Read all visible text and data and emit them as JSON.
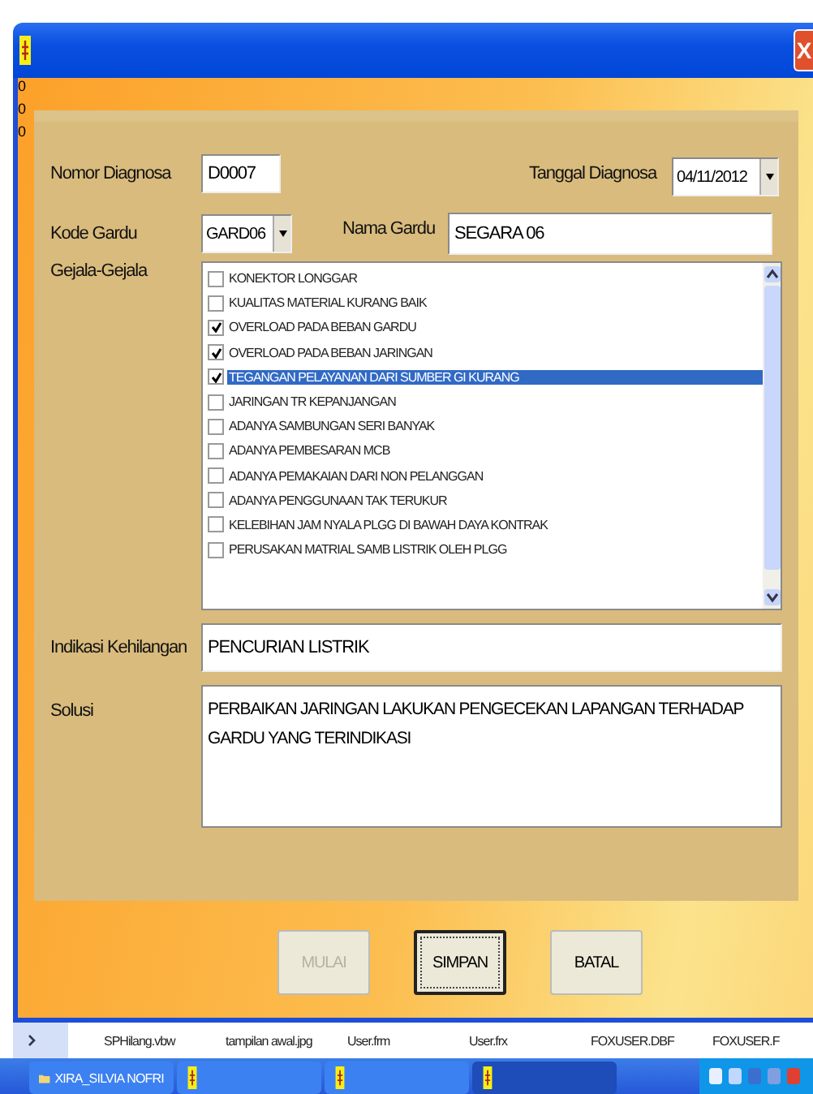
{
  "window": {
    "close": "X"
  },
  "side_marks": [
    "0",
    "0",
    "0"
  ],
  "form": {
    "nomor_label": "Nomor Diagnosa",
    "nomor_value": "D0007",
    "tanggal_label": "Tanggal Diagnosa",
    "tanggal_value": "04/11/2012",
    "kode_label": "Kode Gardu",
    "kode_value": "GARD06",
    "nama_label": "Nama Gardu",
    "nama_value": "SEGARA 06",
    "gejala_label": "Gejala-Gejala",
    "gejala": [
      {
        "label": "KONEKTOR LONGGAR",
        "checked": false,
        "selected": false
      },
      {
        "label": "KUALITAS MATERIAL KURANG BAIK",
        "checked": false,
        "selected": false
      },
      {
        "label": "OVERLOAD PADA BEBAN GARDU",
        "checked": true,
        "selected": false
      },
      {
        "label": "OVERLOAD PADA BEBAN JARINGAN",
        "checked": true,
        "selected": false
      },
      {
        "label": "TEGANGAN PELAYANAN DARI SUMBER GI KURANG",
        "checked": true,
        "selected": true
      },
      {
        "label": "JARINGAN TR KEPANJANGAN",
        "checked": false,
        "selected": false
      },
      {
        "label": "ADANYA SAMBUNGAN SERI BANYAK",
        "checked": false,
        "selected": false
      },
      {
        "label": "ADANYA PEMBESARAN MCB",
        "checked": false,
        "selected": false
      },
      {
        "label": "ADANYA PEMAKAIAN DARI NON PELANGGAN",
        "checked": false,
        "selected": false
      },
      {
        "label": "ADANYA PENGGUNAAN TAK TERUKUR",
        "checked": false,
        "selected": false
      },
      {
        "label": "KELEBIHAN JAM NYALA PLGG DI BAWAH DAYA KONTRAK",
        "checked": false,
        "selected": false
      },
      {
        "label": "PERUSAKAN MATRIAL SAMB LISTRIK OLEH PLGG",
        "checked": false,
        "selected": false
      }
    ],
    "indikasi_label": "Indikasi Kehilangan",
    "indikasi_value": "PENCURIAN LISTRIK",
    "solusi_label": "Solusi",
    "solusi_value": "PERBAIKAN JARINGAN LAKUKAN PENGECEKAN LAPANGAN TERHADAP GARDU YANG TERINDIKASI"
  },
  "buttons": [
    {
      "label": "MULAI",
      "disabled": true,
      "focused": false
    },
    {
      "label": "SIMPAN",
      "disabled": false,
      "focused": true
    },
    {
      "label": "BATAL",
      "disabled": false,
      "focused": false
    }
  ],
  "files": [
    "SPHilang.vbw",
    "tampilan awal.jpg",
    "User.frm",
    "User.frx",
    "FOXUSER.DBF",
    "FOXUSER.F"
  ],
  "taskbar": [
    {
      "label": "XIRA_SILVIA NOFRI",
      "kind": "folder",
      "selected": false
    },
    {
      "kind": "app",
      "selected": false
    },
    {
      "kind": "app",
      "selected": false
    },
    {
      "kind": "app",
      "selected": true
    }
  ]
}
